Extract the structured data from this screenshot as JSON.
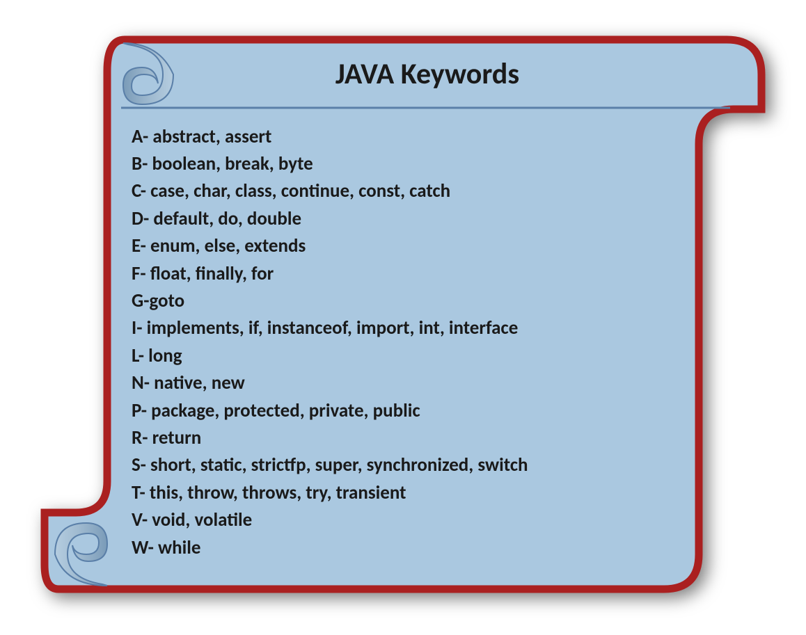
{
  "title": "JAVA Keywords",
  "keywords": [
    "A- abstract, assert",
    "B- boolean, break, byte",
    "C- case, char, class, continue, const, catch",
    "D- default, do, double",
    "E- enum, else, extends",
    "F- float, finally, for",
    "G-goto",
    "I- implements, if, instanceof, import, int, interface",
    "L- long",
    "N- native, new",
    "P- package, protected, private, public",
    "R- return",
    "S- short, static, strictfp, super, synchronized, switch",
    "T- this, throw, throws, try, transient",
    "V- void, volatile",
    "W- while"
  ]
}
